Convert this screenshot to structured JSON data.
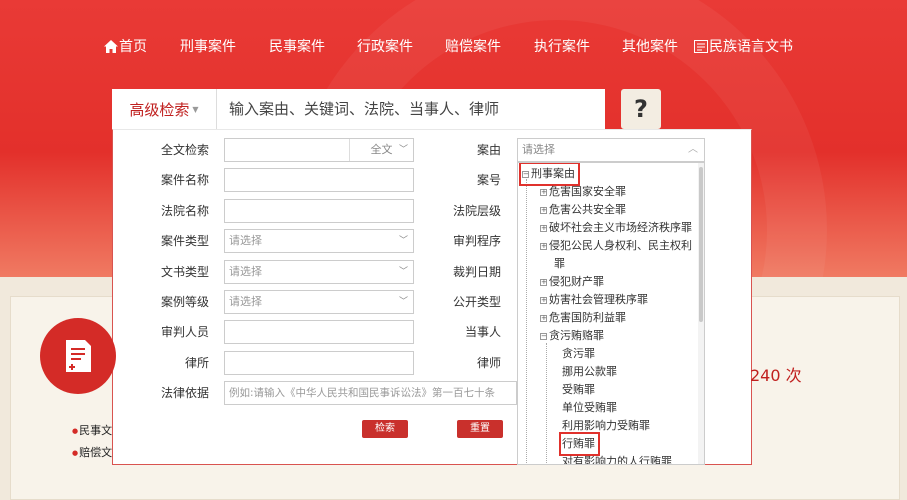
{
  "nav": {
    "home": "首页",
    "criminal": "刑事案件",
    "civil": "民事案件",
    "administrative": "行政案件",
    "compensation": "赔偿案件",
    "enforcement": "执行案件",
    "other": "其他案件",
    "ethnic_docs": "民族语言文书"
  },
  "search": {
    "advanced_label": "高级检索",
    "placeholder": "输入案由、关键词、法院、当事人、律师",
    "help_label": "?"
  },
  "form": {
    "fulltext_label": "全文检索",
    "fulltext_scope": "全文",
    "case_name_label": "案件名称",
    "court_name_label": "法院名称",
    "case_type_label": "案件类型",
    "case_type_value": "请选择",
    "doc_type_label": "文书类型",
    "doc_type_value": "请选择",
    "case_level_label": "案例等级",
    "case_level_value": "请选择",
    "judge_label": "审判人员",
    "lawfirm_label": "律所",
    "legal_basis_label": "法律依据",
    "legal_basis_placeholder": "例如:请输入《中华人民共和国民事诉讼法》第一百七十条",
    "cause_label": "案由",
    "cause_value": "请选择",
    "case_no_label": "案号",
    "court_level_label": "法院层级",
    "trial_procedure_label": "审判程序",
    "judgment_date_label": "裁判日期",
    "publish_type_label": "公开类型",
    "party_label": "当事人",
    "lawyer_label": "律师",
    "search_button": "检索",
    "reset_button": "重置"
  },
  "tree": {
    "root": "刑事案由",
    "items": [
      "危害国家安全罪",
      "危害公共安全罪",
      "破坏社会主义市场经济秩序罪",
      "侵犯公民人身权利、民主权利",
      "罪",
      "侵犯财产罪",
      "妨害社会管理秩序罪",
      "危害国防利益罪",
      "贪污贿赂罪"
    ],
    "children": [
      "贪污罪",
      "挪用公款罪",
      "受贿罪",
      "单位受贿罪",
      "利用影响力受贿罪",
      "行贿罪",
      "对有影响力的人行贿罪"
    ]
  },
  "background": {
    "bullet1": "民事文",
    "bullet2": "赔偿文",
    "count_text": "240 次"
  },
  "colors": {
    "brand_red": "#e3302b",
    "accent_red": "#c9302c",
    "cream": "#f1e9dc"
  },
  "icons": {
    "home": "home-icon",
    "ethnic": "ethnic-docs-icon",
    "emblem": "document-plus-icon"
  }
}
